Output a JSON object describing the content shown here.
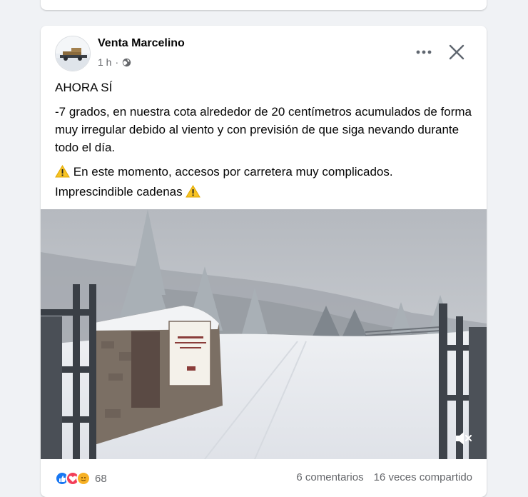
{
  "post": {
    "author": "Venta Marcelino",
    "time": "1 h",
    "separator": "·",
    "privacy_icon": "globe-icon",
    "more_icon": "more-options-icon",
    "close_icon": "close-icon",
    "paragraphs": {
      "p1": "AHORA SÍ",
      "p2": "-7 grados, en nuestra cota alrededor de 20 centímetros acumulados de forma muy irregular debido al viento y con previsión de que siga nevando durante todo el día.",
      "p3": "En este momento, accesos por carretera muy complicados.",
      "p4": "Imprescindible cadenas"
    },
    "warning_icon": "warning-icon",
    "media": {
      "type": "video",
      "mute_icon": "muted-speaker-icon"
    },
    "footer": {
      "reaction_icons": [
        "like-icon",
        "love-icon",
        "care-icon"
      ],
      "reaction_count": "68",
      "comments": "6 comentarios",
      "shares": "16 veces compartido"
    },
    "colors": {
      "like": "#1877f2",
      "love": "#f33e58",
      "care": "#f7b125",
      "meta_text": "#65676b"
    }
  }
}
